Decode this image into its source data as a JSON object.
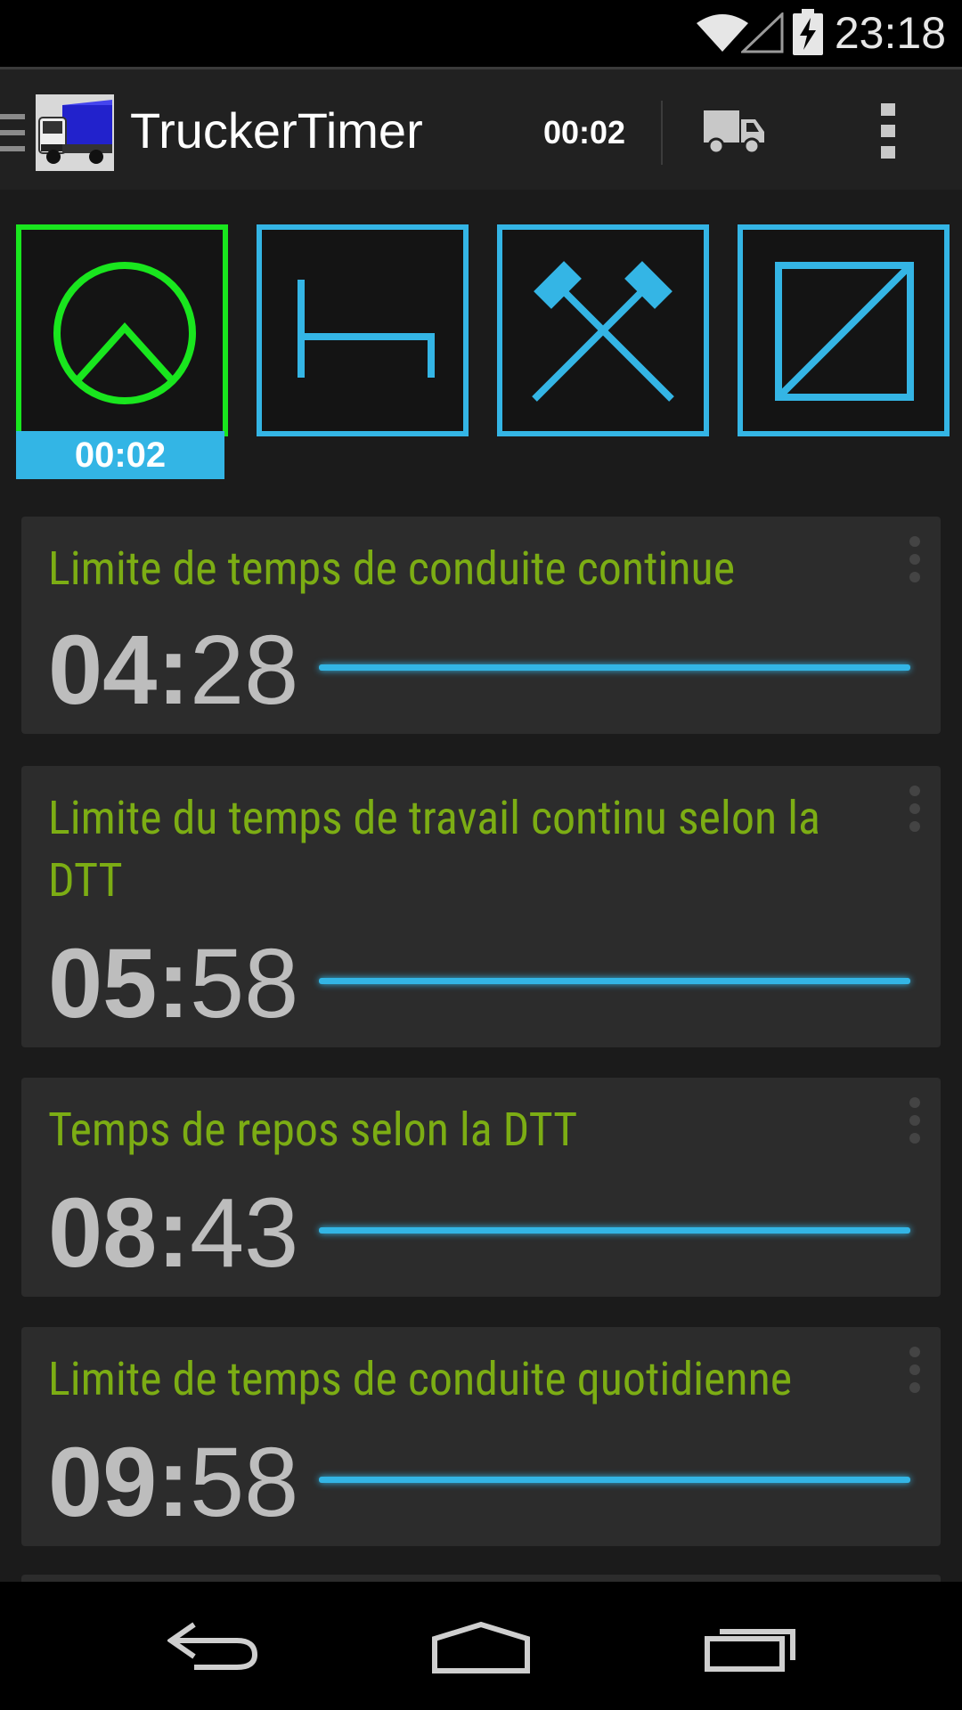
{
  "status_bar": {
    "time": "23:18"
  },
  "action_bar": {
    "title": "TruckerTimer",
    "timer": "00:02"
  },
  "modes": {
    "items": [
      {
        "name": "driving",
        "active": true
      },
      {
        "name": "rest",
        "active": false
      },
      {
        "name": "work",
        "active": false
      },
      {
        "name": "availability",
        "active": false
      }
    ],
    "active_timer": "00:02"
  },
  "cards": [
    {
      "title": "Limite de temps de conduite continue",
      "hours": "04:",
      "minutes": "28",
      "progress": 1.0
    },
    {
      "title": "Limite du temps de travail continu selon la DTT",
      "hours": "05:",
      "minutes": "58",
      "progress": 1.0
    },
    {
      "title": "Temps de repos selon la DTT",
      "hours": "08:",
      "minutes": "43",
      "progress": 1.0
    },
    {
      "title": "Limite de temps de conduite quotidienne",
      "hours": "09:",
      "minutes": "58",
      "progress": 1.0
    }
  ],
  "colors": {
    "accent": "#33b5e5",
    "active": "#19e61e",
    "title_green": "#7cad14"
  }
}
